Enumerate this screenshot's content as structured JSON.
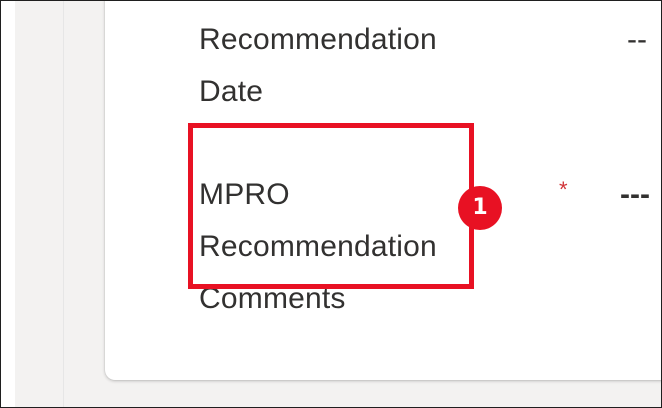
{
  "form": {
    "fields": [
      {
        "label_line1": "Recommendation",
        "label_line2": "Date",
        "value": "--"
      },
      {
        "label_line1": "MPRO",
        "label_line2": "Recommendation",
        "label_line3": "Comments",
        "required_marker": "*",
        "value": "---"
      }
    ]
  },
  "annotation": {
    "badge_number": "1",
    "color": "#e81123"
  }
}
